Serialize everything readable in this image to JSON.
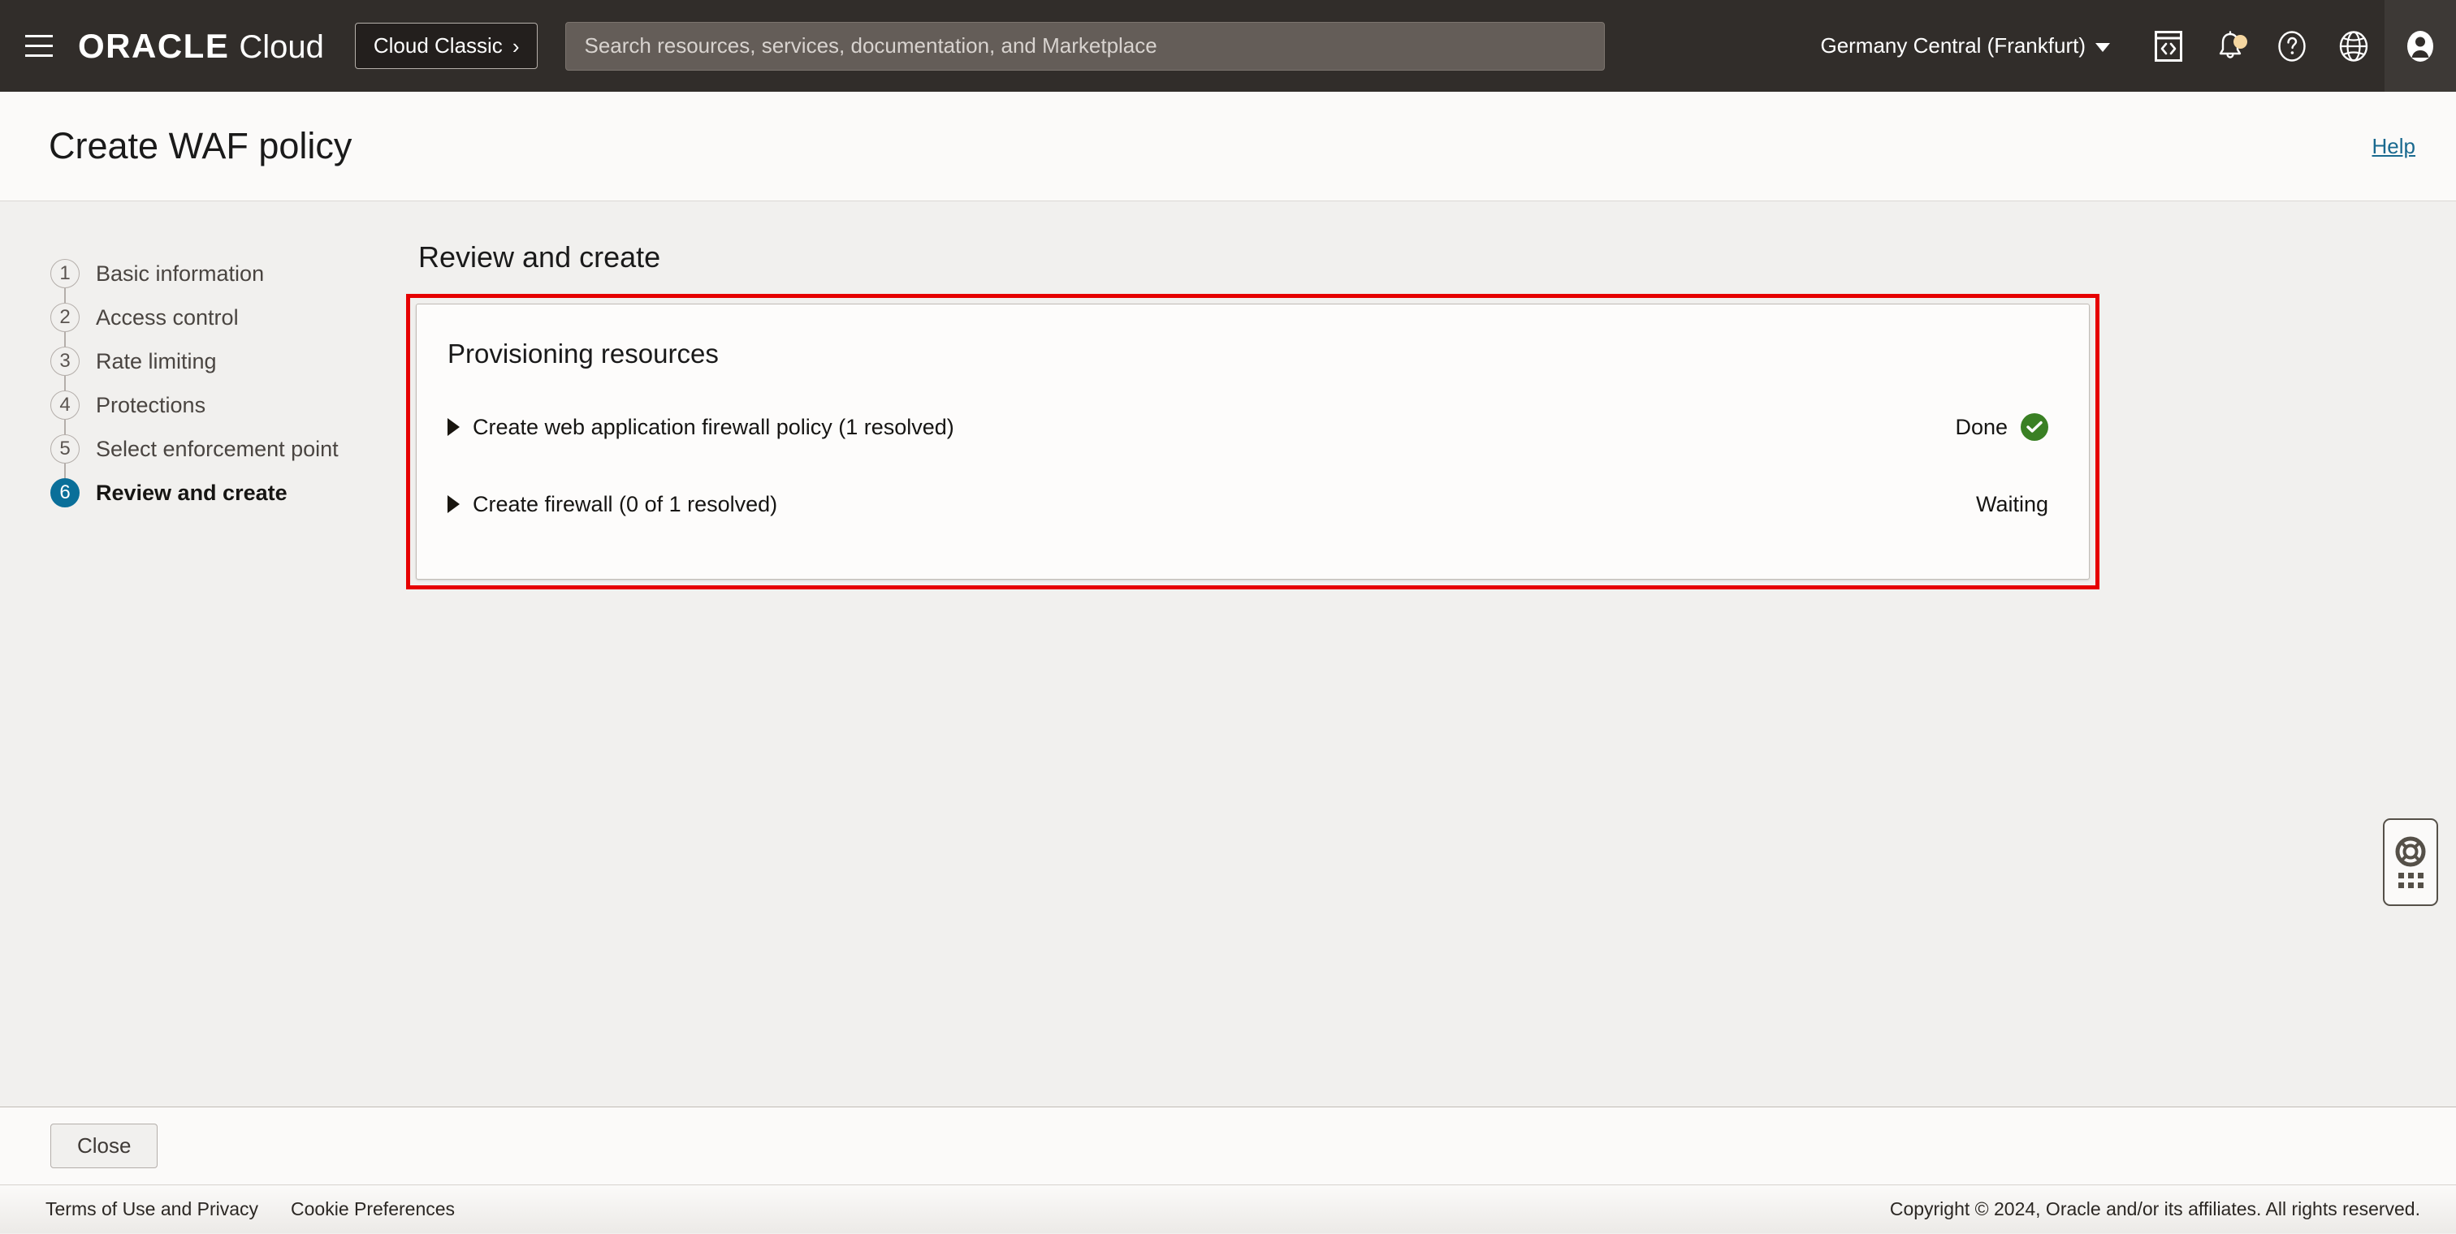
{
  "topnav": {
    "menu_icon": "hamburger-menu-icon",
    "brand_oracle": "ORACLE",
    "brand_cloud": "Cloud",
    "cloud_classic_label": "Cloud Classic",
    "cloud_classic_chevron": "›",
    "search": {
      "placeholder": "Search resources, services, documentation, and Marketplace",
      "value": ""
    },
    "region": "Germany Central (Frankfurt)",
    "icons": [
      {
        "name": "cloud-shell-icon"
      },
      {
        "name": "notifications-bell-icon",
        "badge": true
      },
      {
        "name": "help-question-icon"
      },
      {
        "name": "language-globe-icon"
      },
      {
        "name": "user-avatar-icon"
      }
    ],
    "background": "#312d2a"
  },
  "page_header": {
    "title": "Create WAF policy",
    "help_label": "Help",
    "help_color": "#19698f"
  },
  "wizard": {
    "steps": [
      {
        "num": "1",
        "label": "Basic information",
        "active": false
      },
      {
        "num": "2",
        "label": "Access control",
        "active": false
      },
      {
        "num": "3",
        "label": "Rate limiting",
        "active": false
      },
      {
        "num": "4",
        "label": "Protections",
        "active": false
      },
      {
        "num": "5",
        "label": "Select enforcement point",
        "active": false
      },
      {
        "num": "6",
        "label": "Review and create",
        "active": true
      }
    ],
    "active_color": "#0a6f99"
  },
  "main": {
    "section_title": "Review and create",
    "highlight_color": "#e60000",
    "card": {
      "title": "Provisioning resources",
      "rows": [
        {
          "label": "Create web application firewall policy (1 resolved)",
          "status": "Done",
          "status_icon": "green-check-circle-icon",
          "status_color": "#3a8024"
        },
        {
          "label": "Create firewall (0 of 1 resolved)",
          "status": "Waiting",
          "status_icon": null,
          "status_color": null
        }
      ]
    }
  },
  "support_widget": {
    "icon": "life-ring-support-icon",
    "handle": "drag-handle-dots-icon"
  },
  "action_bar": {
    "close_label": "Close"
  },
  "footer": {
    "terms_label": "Terms of Use and Privacy",
    "cookie_label": "Cookie Preferences",
    "copyright": "Copyright © 2024, Oracle and/or its affiliates. All rights reserved."
  }
}
